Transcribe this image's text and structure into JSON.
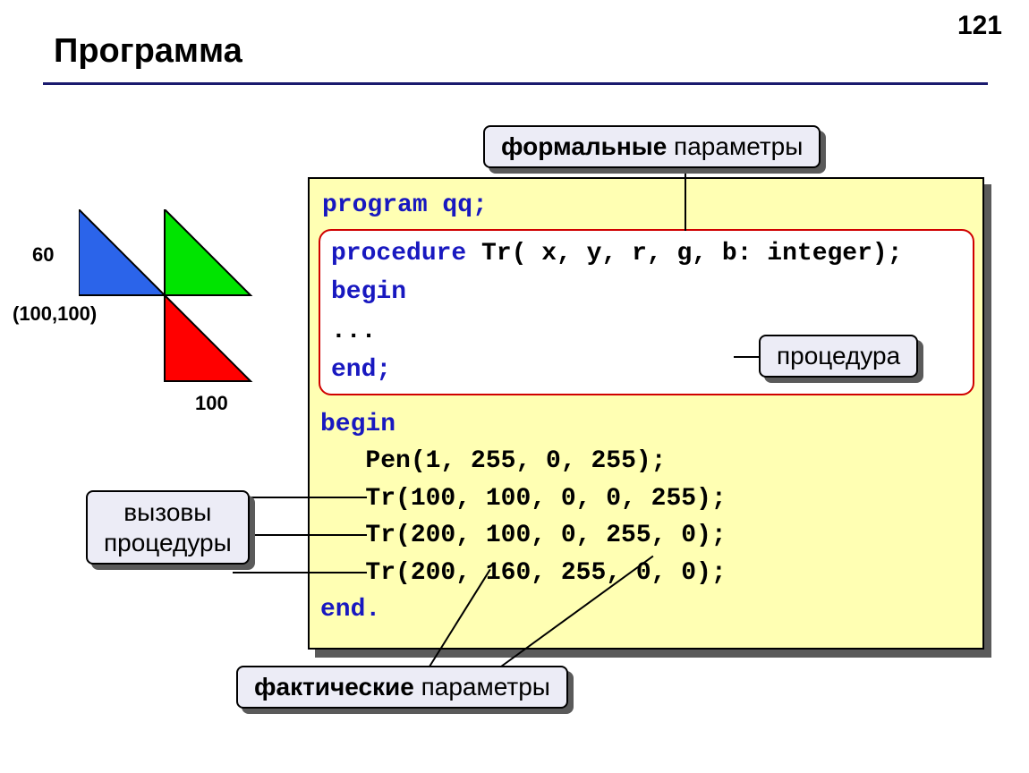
{
  "page_number": "121",
  "title": "Программа",
  "callouts": {
    "formal_strong": "формальные",
    "formal_rest": " параметры",
    "procedure": "процедура",
    "calls_line1": "вызовы",
    "calls_line2": "процедуры",
    "actual_strong": "фактические",
    "actual_rest": " параметры"
  },
  "diagram": {
    "label_60": "60",
    "label_coord": "(100,100)",
    "label_100": "100"
  },
  "code": {
    "program": "program qq;",
    "proc_line1_a": "procedure",
    "proc_line1_b": " Tr( x, y, r, g, b: integer);",
    "proc_begin": "begin",
    "proc_dots": "  ...",
    "proc_end": "end;",
    "begin": "begin",
    "l1a": "   Pen",
    "l1b": "(1, 255, 0, 255);",
    "l2a": "   Tr",
    "l2b": "(100, 100, 0, 0, 255);",
    "l3a": "   Tr",
    "l3b": "(200, 100, 0, 255, 0);",
    "l4a": "   Tr",
    "l4b": "(200, 160, 255, 0, 0);",
    "end": "end."
  }
}
